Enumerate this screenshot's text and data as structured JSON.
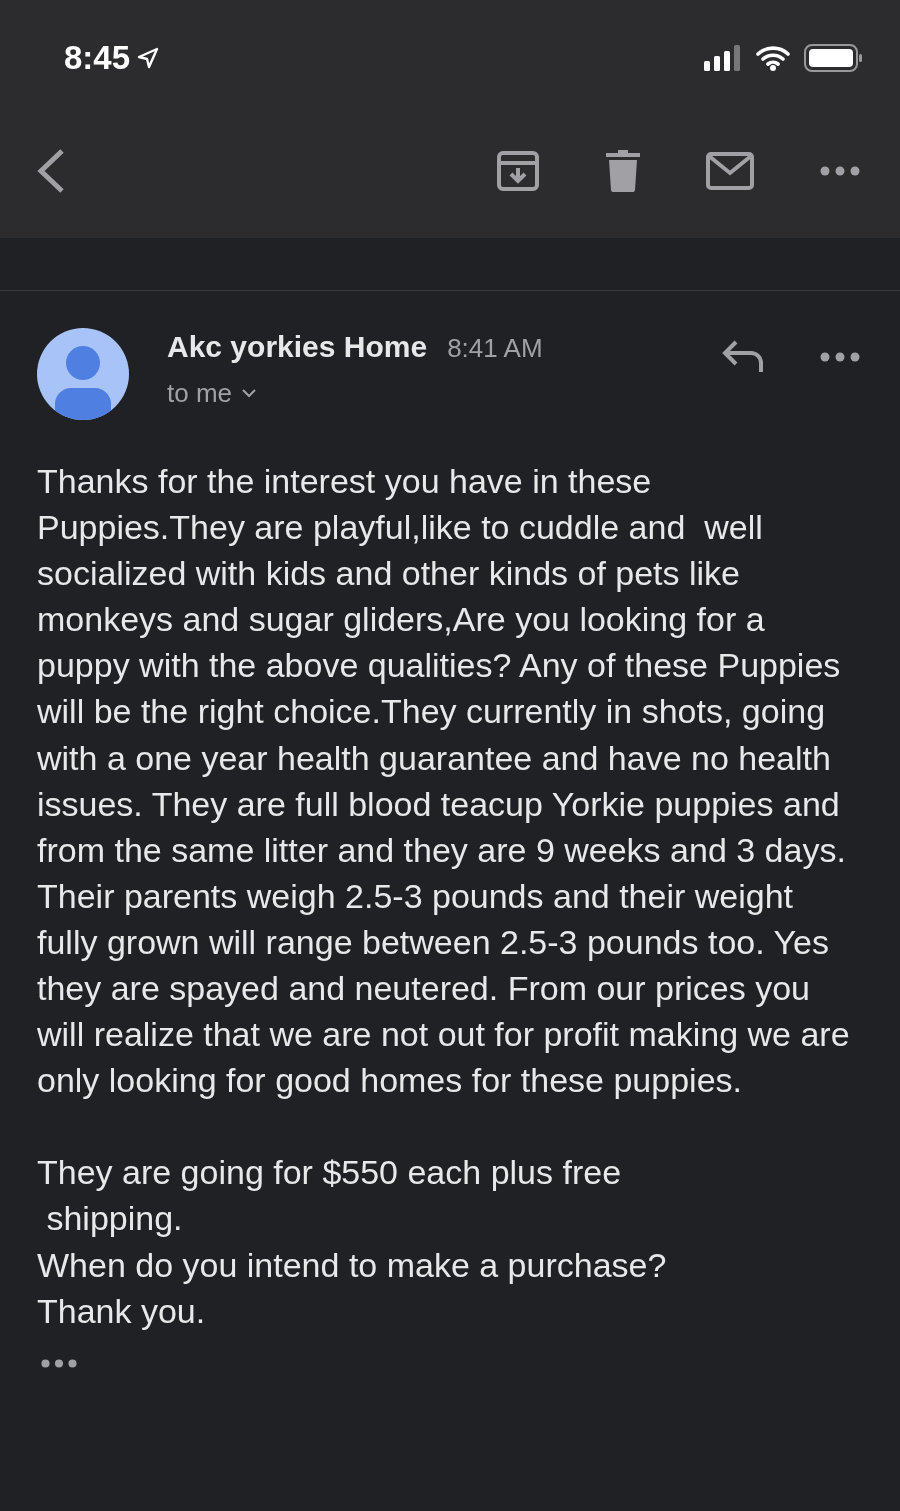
{
  "status_bar": {
    "time": "8:45"
  },
  "message": {
    "sender": "Akc yorkies Home",
    "time": "8:41 AM",
    "recipient": "to me",
    "body": [
      "Thanks for the interest you have in these Puppies.They are playful,like to cuddle and  well socialized with kids and other kinds of pets like monkeys and sugar gliders,Are you looking for a puppy with the above qualities? Any of these Puppies will be the right choice.They currently in shots, going with a one year health guarantee and have no health issues. They are full blood teacup Yorkie puppies and from the same litter and they are 9 weeks and 3 days. Their parents weigh 2.5-3 pounds and their weight fully grown will range between 2.5-3 pounds too. Yes they are spayed and neutered. From our prices you will realize that we are not out for profit making we are only looking for good homes for these puppies.",
      "They are going for $550 each plus free\n shipping.\nWhen do you intend to make a purchase?\nThank you."
    ]
  }
}
